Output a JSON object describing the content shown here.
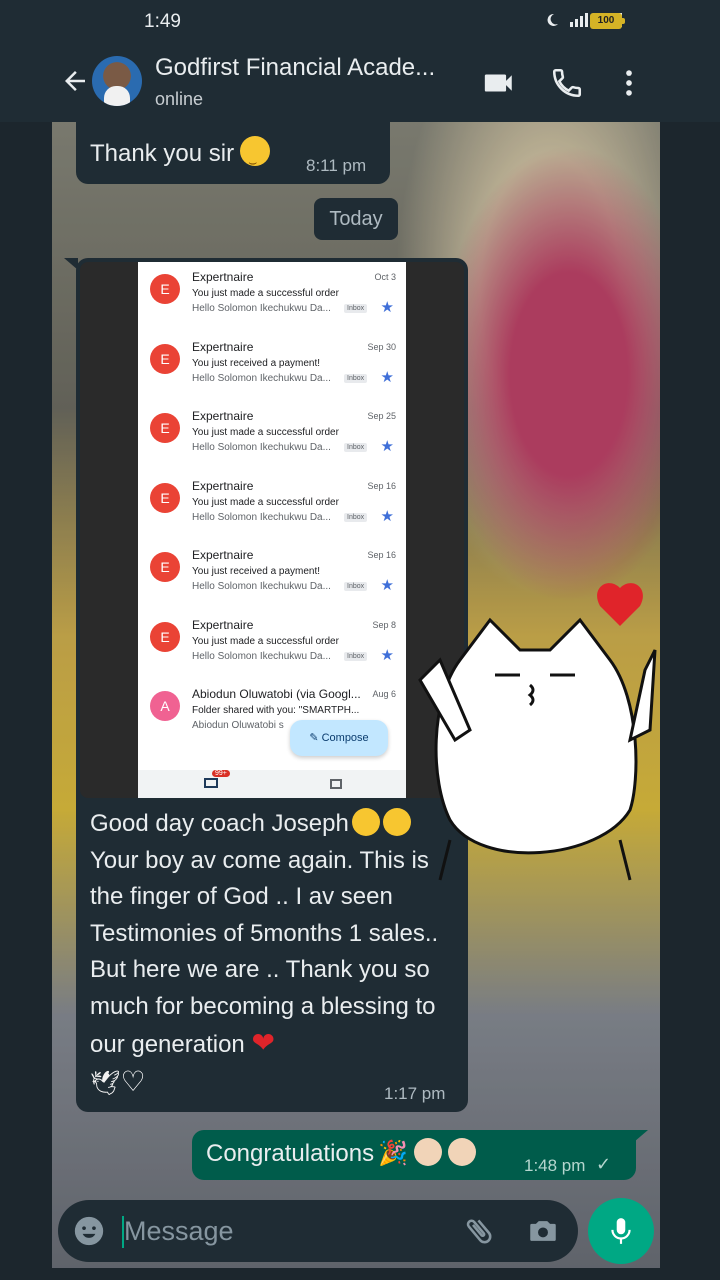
{
  "status_bar": {
    "time": "1:49",
    "battery": "100"
  },
  "header": {
    "title": "Godfirst Financial Acade...",
    "status": "online"
  },
  "messages": {
    "m1": {
      "text": "Thank you sir",
      "time": "8:11 pm"
    },
    "date_divider": "Today",
    "m2": {
      "line1": "Good day coach Joseph",
      "text": "Your boy av come again. This is the finger of God .. I av seen Testimonies of 5months 1 sales.. But here we are .. Thank you so much for becoming a blessing to our generation",
      "time": "1:17 pm"
    },
    "m3": {
      "text": "Congratulations",
      "time": "1:48 pm"
    }
  },
  "screenshot_mail": {
    "rows": [
      {
        "avatar": "E",
        "sender": "Expertnaire",
        "date": "Oct 3",
        "subject": "You just made a successful order",
        "preview": "Hello Solomon Ikechukwu Da...",
        "tag": "Inbox"
      },
      {
        "avatar": "E",
        "sender": "Expertnaire",
        "date": "Sep 30",
        "subject": "You just received a payment!",
        "preview": "Hello Solomon Ikechukwu Da...",
        "tag": "Inbox"
      },
      {
        "avatar": "E",
        "sender": "Expertnaire",
        "date": "Sep 25",
        "subject": "You just made a successful order",
        "preview": "Hello Solomon Ikechukwu Da...",
        "tag": "Inbox"
      },
      {
        "avatar": "E",
        "sender": "Expertnaire",
        "date": "Sep 16",
        "subject": "You just made a successful order",
        "preview": "Hello Solomon Ikechukwu Da...",
        "tag": "Inbox"
      },
      {
        "avatar": "E",
        "sender": "Expertnaire",
        "date": "Sep 16",
        "subject": "You just received a payment!",
        "preview": "Hello Solomon Ikechukwu Da...",
        "tag": "Inbox"
      },
      {
        "avatar": "E",
        "sender": "Expertnaire",
        "date": "Sep 8",
        "subject": "You just made a successful order",
        "preview": "Hello Solomon Ikechukwu Da...",
        "tag": "Inbox"
      },
      {
        "avatar": "A",
        "sender": "Abiodun Oluwatobi (via Googl...",
        "date": "Aug 6",
        "subject": "Folder shared with you: \"SMARTPH...",
        "preview": "Abiodun Oluwatobi s",
        "tag": ""
      }
    ],
    "compose_label": "Compose",
    "badge": "99+"
  },
  "input": {
    "placeholder": "Message"
  },
  "colors": {
    "header_bg": "#1f2c34",
    "incoming_bubble": "#1f2c34",
    "outgoing_bubble": "#005c4b",
    "accent": "#00a884",
    "mail_avatar_e": "#ea4335",
    "mail_avatar_a": "#f06292"
  },
  "icons": [
    "back-arrow-icon",
    "video-call-icon",
    "phone-icon",
    "more-vert-icon",
    "emoji-icon",
    "attach-icon",
    "camera-icon",
    "mic-icon"
  ]
}
